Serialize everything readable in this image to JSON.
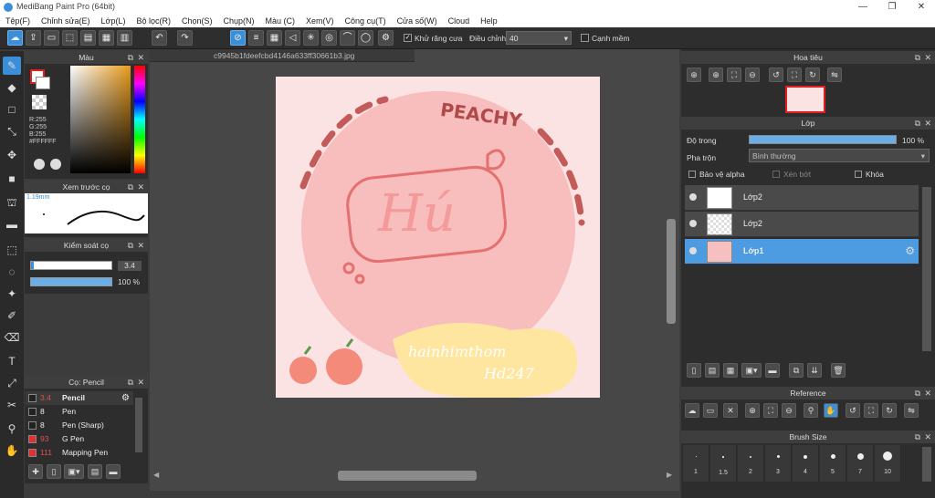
{
  "window": {
    "title": "MediBang Paint Pro (64bit)"
  },
  "menu": [
    "Tệp(F)",
    "Chỉnh sửa(E)",
    "Lớp(L)",
    "Bộ lọc(R)",
    "Chọn(S)",
    "Chụp(N)",
    "Màu (C)",
    "Xem(V)",
    "Công cụ(T)",
    "Cửa số(W)",
    "Cloud",
    "Help"
  ],
  "toolbar": {
    "antialias_label": "Khử răng cưa",
    "adjust_label": "Điều chỉnh",
    "adjust_value": "40",
    "edge_label": "Cạnh mềm"
  },
  "color_panel": {
    "title": "Màu",
    "r": "R:255",
    "g": "G:255",
    "b": "B:255",
    "hex": "#FFFFFF"
  },
  "brush_preview": {
    "title": "Xem trước cọ",
    "size": "1.19mm"
  },
  "brush_control": {
    "title": "Kiểm soát cọ",
    "size_value": "3.4",
    "opacity_value": "100 %"
  },
  "brush_list": {
    "title": "Cọ: Pencil",
    "items": [
      {
        "size": "3.4",
        "name": "Pencil",
        "color": "#222222"
      },
      {
        "size": "8",
        "name": "Pen",
        "color": "#222222"
      },
      {
        "size": "8",
        "name": "Pen (Sharp)",
        "color": "#222222"
      },
      {
        "size": "93",
        "name": "G Pen",
        "color": "#e03030"
      },
      {
        "size": "111",
        "name": "Mapping Pen",
        "color": "#e03030"
      }
    ]
  },
  "canvas": {
    "tab_title": "c9945b1fdeefcbd4146a633ff30661b3.jpg",
    "art_top": "PEACHY",
    "art_main": "Hú",
    "art_sub1": "hainhimthom",
    "art_sub2": "Hd247"
  },
  "navigator": {
    "title": "Hoa tiêu"
  },
  "layers": {
    "title": "Lớp",
    "opacity_label": "Độ trong",
    "opacity_value": "100 %",
    "blend_label": "Pha trộn",
    "blend_value": "Bình thường",
    "protect_alpha": "Bảo vệ alpha",
    "clipping": "Xén bớt",
    "lock": "Khóa",
    "items": [
      {
        "name": "Lớp2"
      },
      {
        "name": "Lớp2"
      },
      {
        "name": "Lớp1"
      }
    ]
  },
  "reference": {
    "title": "Reference"
  },
  "brush_size": {
    "title": "Brush Size",
    "sizes": [
      "1",
      "1.5",
      "2",
      "3",
      "4",
      "5",
      "7",
      "10"
    ]
  }
}
